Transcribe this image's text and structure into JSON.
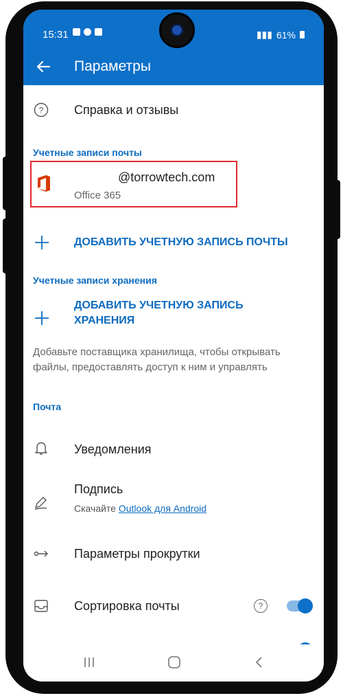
{
  "status": {
    "time": "15:31",
    "right": "61%"
  },
  "appbar": {
    "title": "Параметры"
  },
  "help_row": {
    "label": "Справка и отзывы"
  },
  "mail_accounts": {
    "header": "Учетные записи почты",
    "account_email": "@torrowtech.com",
    "account_type": "Office 365",
    "add_label": "ДОБАВИТЬ УЧЕТНУЮ ЗАПИСЬ ПОЧТЫ"
  },
  "storage_accounts": {
    "header": "Учетные записи хранения",
    "add_label_line1": "ДОБАВИТЬ УЧЕТНУЮ ЗАПИСЬ",
    "add_label_line2": "ХРАНЕНИЯ",
    "helper": "Добавьте поставщика хранилища, чтобы открывать файлы, предоставлять доступ к ним и управлять"
  },
  "mail": {
    "header": "Почта",
    "notifications": "Уведомления",
    "signature": "Подпись",
    "signature_sub_prefix": "Скачайте",
    "signature_sub_link": "Outlook для Android",
    "swipe": "Параметры прокрутки",
    "focused_inbox": "Сортировка почты",
    "help_glyph": "?"
  },
  "colors": {
    "accent": "#0d70c9",
    "highlight_border": "#e0282e",
    "office_red": "#d83b01"
  },
  "icons": [
    "back-arrow-icon",
    "help-circle-icon",
    "office-icon",
    "plus-icon",
    "bell-icon",
    "signature-pen-icon",
    "swipe-arrows-icon",
    "inbox-icon"
  ]
}
